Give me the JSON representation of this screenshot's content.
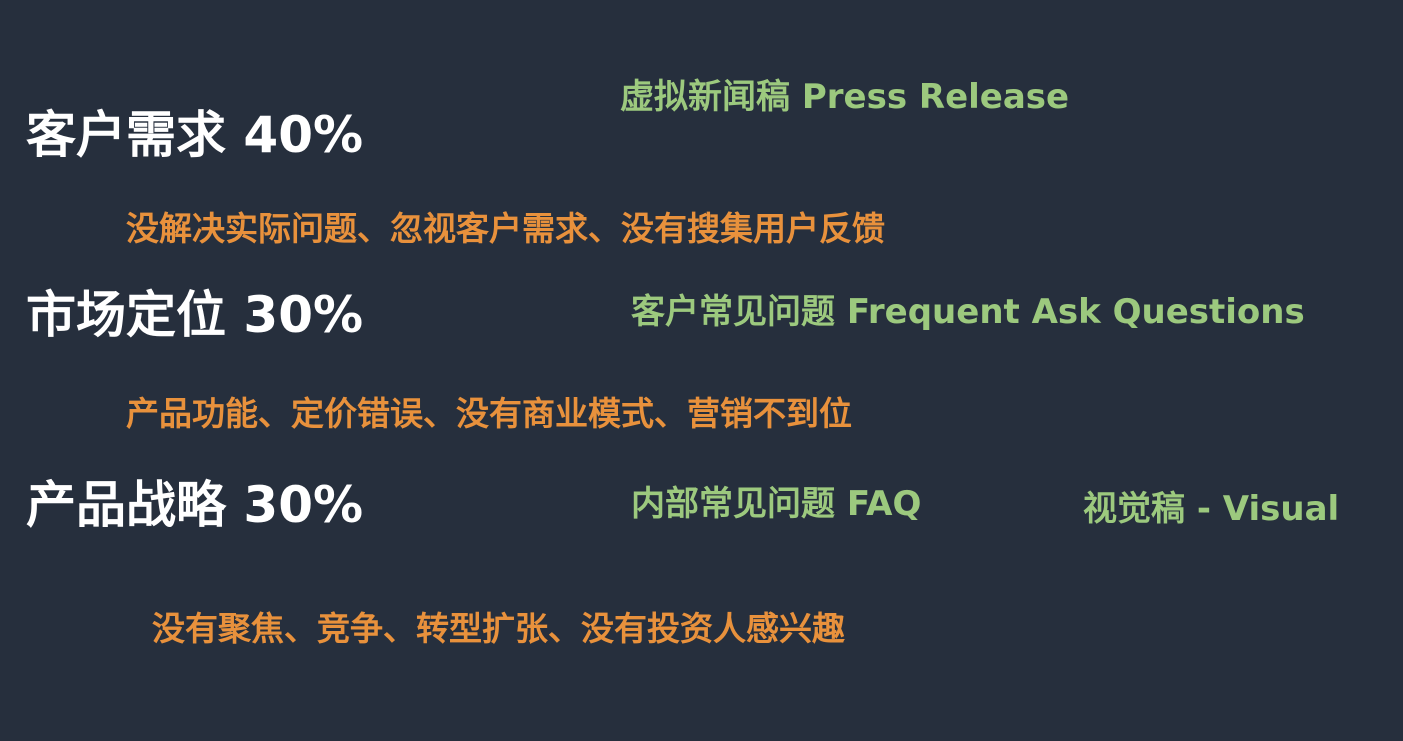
{
  "categories": [
    {
      "heading": "客户需求 40%",
      "reason": "没解决实际问题、忽视客户需求、没有搜集用户反馈"
    },
    {
      "heading": "市场定位 30%",
      "reason": "产品功能、定价错误、没有商业模式、营销不到位"
    },
    {
      "heading": "产品战略 30%",
      "reason": "没有聚焦、竞争、转型扩张、没有投资人感兴趣"
    }
  ],
  "documents": {
    "press_release": "虚拟新闻稿 Press Release",
    "customer_faq": "客户常见问题 Frequent Ask Questions",
    "internal_faq": "内部常见问题 FAQ",
    "visual": "视觉稿 - Visual"
  },
  "colors": {
    "background": "#262f3d",
    "heading": "#ffffff",
    "reason": "#e8913c",
    "document": "#9cc97e"
  }
}
